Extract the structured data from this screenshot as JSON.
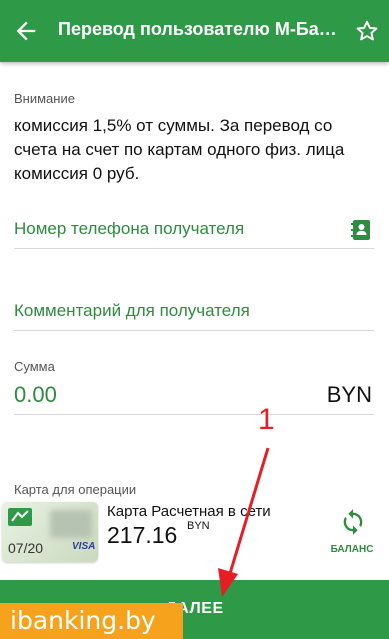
{
  "appbar": {
    "title": "Перевод пользователю М-Банкинга",
    "back_icon": "arrow-back-icon",
    "star_icon": "star-outline-icon",
    "color": "#2e9a48"
  },
  "notice": {
    "caption": "Внимание",
    "text": "комиссия 1,5% от суммы. За перевод со счета на счет по картам одного физ. лица комиссия 0 руб."
  },
  "phone_field": {
    "placeholder": "Номер телефона получателя",
    "icon": "contacts-icon"
  },
  "comment_field": {
    "placeholder": "Комментарий для получателя"
  },
  "amount": {
    "caption": "Сумма",
    "value": "0.00",
    "currency": "BYN"
  },
  "card": {
    "caption": "Карта для операции",
    "expiry": "07/20",
    "brand": "VISA",
    "name": "Карта Расчетная в сети",
    "balance": "217.16",
    "currency": "BYN"
  },
  "balance_button": {
    "label": "БАЛАНС",
    "icon": "refresh-icon"
  },
  "next_button": {
    "label": "ДАЛЕЕ"
  },
  "watermark": {
    "text": "ibanking.by",
    "color": "#f6a21c"
  },
  "annotation": {
    "number": "1",
    "color": "#e61e24"
  }
}
